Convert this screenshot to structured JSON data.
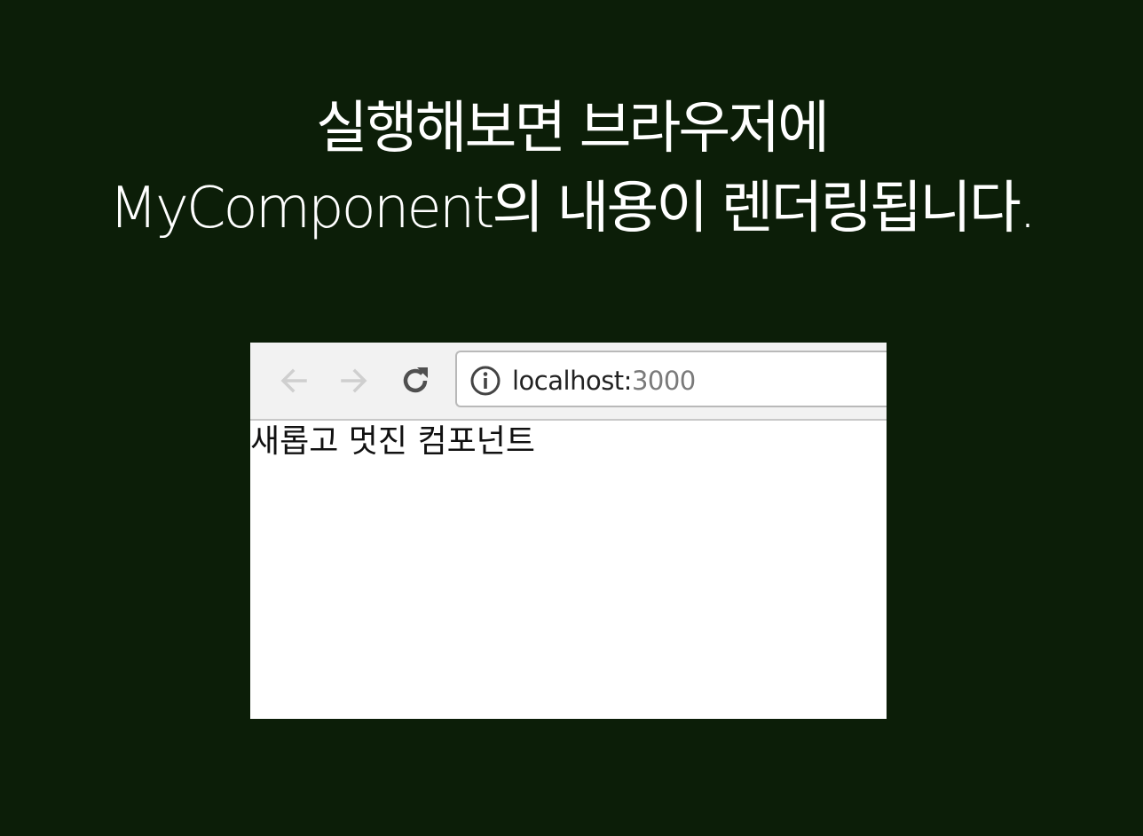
{
  "caption": {
    "line1": "실행해보면 브라우저에",
    "line2": "MyComponent의 내용이 렌더링됩니다."
  },
  "browser": {
    "toolbar": {
      "back_icon": "arrow-left-icon",
      "forward_icon": "arrow-right-icon",
      "reload_icon": "reload-icon",
      "info_icon": "info-icon",
      "url_host": "localhost:",
      "url_port": "3000"
    },
    "page": {
      "text": "새롭고 멋진 컴포넌트"
    }
  },
  "colors": {
    "background": "#0c1e08",
    "caption_text": "#ffffff",
    "toolbar_bg": "#f2f2f2",
    "disabled_icon": "#cfcfcf",
    "active_icon": "#505050"
  }
}
